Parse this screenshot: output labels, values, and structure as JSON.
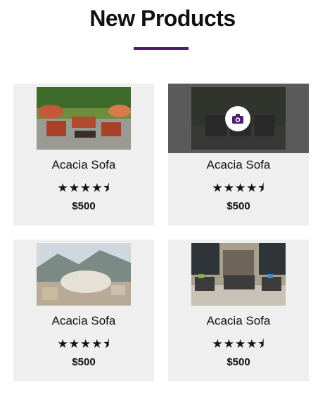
{
  "section": {
    "title": "New Products"
  },
  "colors": {
    "accent": "#4a1f6e",
    "card_bg": "#efefef"
  },
  "products": [
    {
      "name": "Acacia Sofa",
      "rating": 4.5,
      "stars_text": "★★★★⯨",
      "price": "$500",
      "image_icon": "patio-garden-image"
    },
    {
      "name": "Acacia Sofa",
      "rating": 4.5,
      "stars_text": "★★★★⯨",
      "price": "$500",
      "image_icon": "patio-dark-image"
    },
    {
      "name": "Acacia Sofa",
      "rating": 4.5,
      "stars_text": "★★★★⯨",
      "price": "$500",
      "image_icon": "patio-seaview-image"
    },
    {
      "name": "Acacia Sofa",
      "rating": 4.5,
      "stars_text": "★★★★⯨",
      "price": "$500",
      "image_icon": "patio-courtyard-image"
    }
  ],
  "hover": {
    "icon": "camera-icon"
  }
}
